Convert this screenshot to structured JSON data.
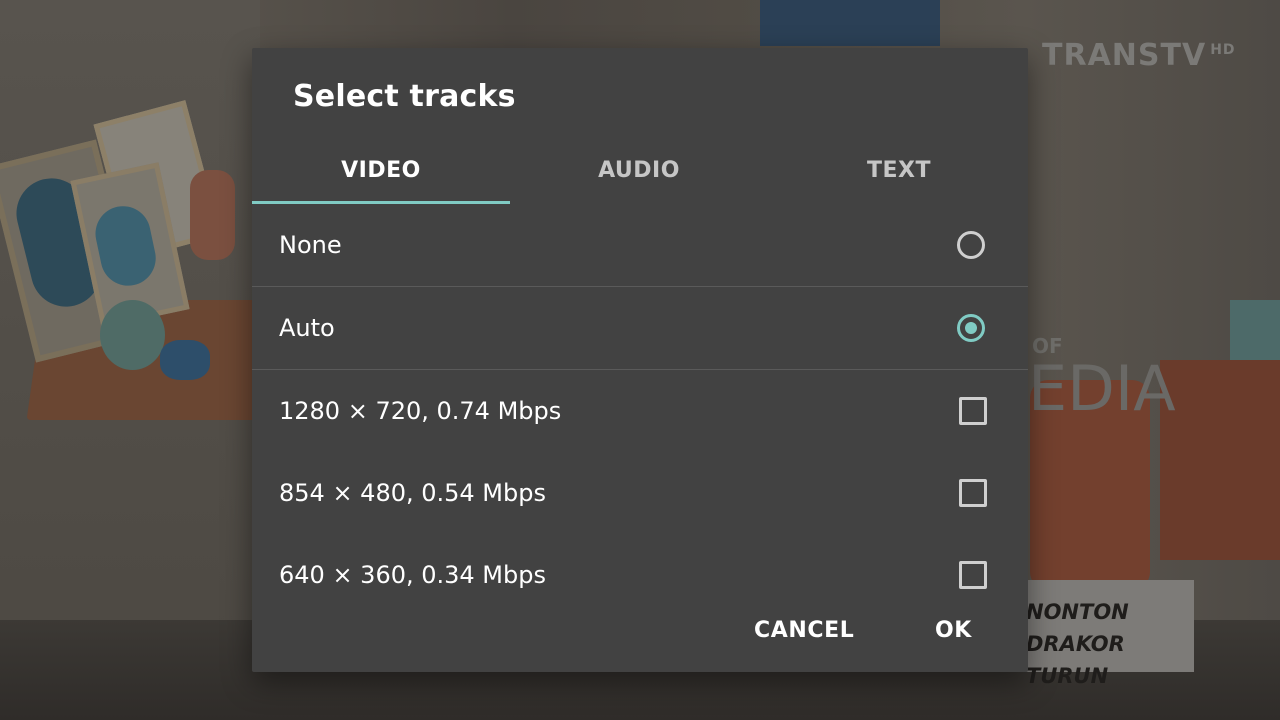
{
  "background": {
    "channel_logo": "TRANSTV",
    "channel_logo_sup": "HD",
    "overlay_of": "OF",
    "overlay_edia": "EDIA",
    "caption_line1": "NONTON DRAKOR",
    "caption_line2": "TURUN"
  },
  "dialog": {
    "title": "Select tracks",
    "tabs": [
      {
        "label": "VIDEO",
        "active": true
      },
      {
        "label": "AUDIO",
        "active": false
      },
      {
        "label": "TEXT",
        "active": false
      }
    ],
    "tracks": [
      {
        "label": "None",
        "control": "radio",
        "checked": false
      },
      {
        "label": "Auto",
        "control": "radio",
        "checked": true
      },
      {
        "label": "1280 × 720, 0.74 Mbps",
        "control": "checkbox",
        "checked": false
      },
      {
        "label": "854 × 480, 0.54 Mbps",
        "control": "checkbox",
        "checked": false
      },
      {
        "label": "640 × 360, 0.34 Mbps",
        "control": "checkbox",
        "checked": false
      }
    ],
    "actions": {
      "cancel": "CANCEL",
      "ok": "OK"
    }
  },
  "colors": {
    "accent": "#80cbc4",
    "dialog_bg": "#424242"
  }
}
